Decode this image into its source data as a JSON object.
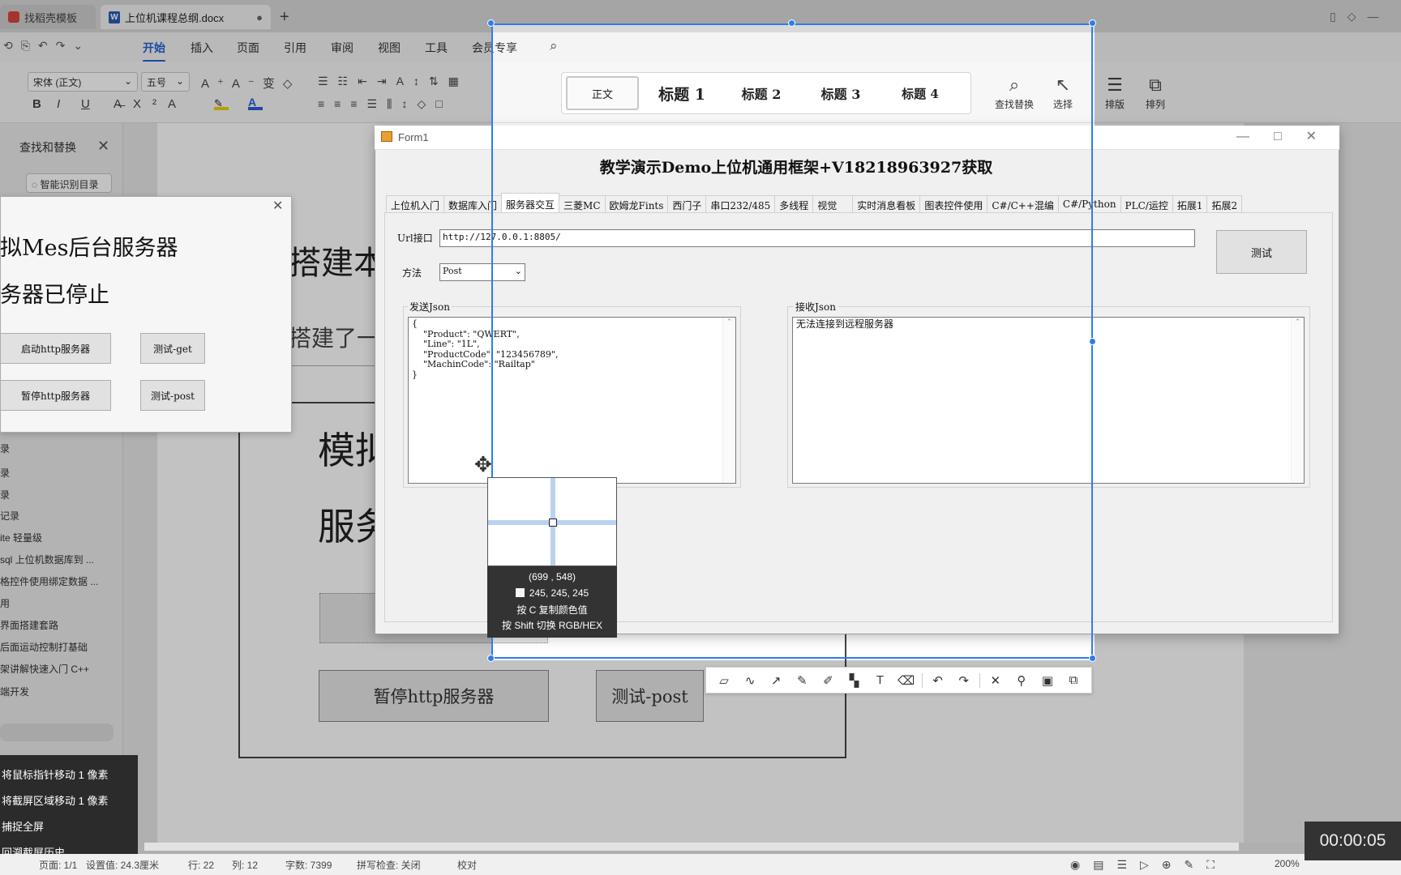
{
  "browser_tabs": [
    {
      "label": "找稻壳模板"
    },
    {
      "label": "上位机课程总纲.docx"
    }
  ],
  "menu": [
    "开始",
    "插入",
    "页面",
    "引用",
    "审阅",
    "视图",
    "工具",
    "会员专享"
  ],
  "ribbon": {
    "font_name": "宋体 (正文)",
    "font_size": "五号",
    "styles": [
      "正文",
      "标题 1",
      "标题 2",
      "标题 3",
      "标题 4"
    ],
    "find_replace": "查找替换",
    "select": "选择",
    "layout": "排版",
    "arrange": "排列"
  },
  "nav_pane": {
    "find_replace_title": "查找和替换",
    "smart_toc": "智能识别目录",
    "items": [
      "录",
      "录",
      "录",
      "记录",
      "ite 轻量级",
      "sql 上位机数据库到 ...",
      "格控件使用绑定数据 ...",
      "用",
      "界面搭建套路",
      "后面运动控制打基础",
      "架讲解快速入门 C++",
      "端开发"
    ]
  },
  "doc": {
    "heading_fragment": "搭建本",
    "line_fragment": "搭建了一",
    "big_char_1": "模拟",
    "big_char_2": "服务",
    "btn_stop": "暂停http服务器",
    "btn_post": "测试-post"
  },
  "mes_window": {
    "title1": "拟Mes后台服务器",
    "title2": "务器已停止",
    "btn_start": "启动http服务器",
    "btn_get": "测试-get",
    "btn_stop": "暂停http服务器",
    "btn_post": "测试-post"
  },
  "form1": {
    "title": "Form1",
    "header": "教学演示Demo上位机通用框架+V18218963927获取",
    "tabs": [
      "上位机入门",
      "数据库入门",
      "服务器交互",
      "三菱MC",
      "欧姆龙Fints",
      "西门子",
      "串口232/485",
      "多线程",
      "视觉",
      "实时消息看板",
      "图表控件使用",
      "C#/C++混编",
      "C#/Python",
      "PLC/运控",
      "拓展1",
      "拓展2"
    ],
    "active_tab": "服务器交互",
    "url_label": "Url接口",
    "url_value": "http://127.0.0.1:8805/",
    "method_label": "方法",
    "method_value": "Post",
    "test_button": "测试",
    "send_label": "发送Json",
    "send_json": "{\n    \"Product\": \"QWERT\",\n    \"Line\": \"1L\",\n    \"ProductCode\": \"123456789\",\n    \"MachinCode\": \"Railtap\"\n}",
    "recv_label": "接收Json",
    "recv_text": "无法连接到远程服务器"
  },
  "magnifier": {
    "coords": "(699 , 548)",
    "rgb": "245, 245, 245",
    "hint_copy": "按 C 复制颜色值",
    "hint_shift": "按 Shift 切换 RGB/HEX"
  },
  "shortcuts": [
    "将鼠标指针移动 1 像素",
    "将截屏区域移动 1 像素",
    "捕捉全屏",
    "回溯截屏历史"
  ],
  "statusbar": {
    "page": "页面: 1/1",
    "setting": "设置值: 24.3厘米",
    "row": "行: 22",
    "col": "列: 12",
    "words": "字数: 7399",
    "spell": "拼写检查: 关闭",
    "proof": "校对",
    "zoom": "200%"
  },
  "timer": "00:00:05",
  "colors": {
    "accent": "#2f7dea",
    "wps_blue": "#2660d6"
  }
}
